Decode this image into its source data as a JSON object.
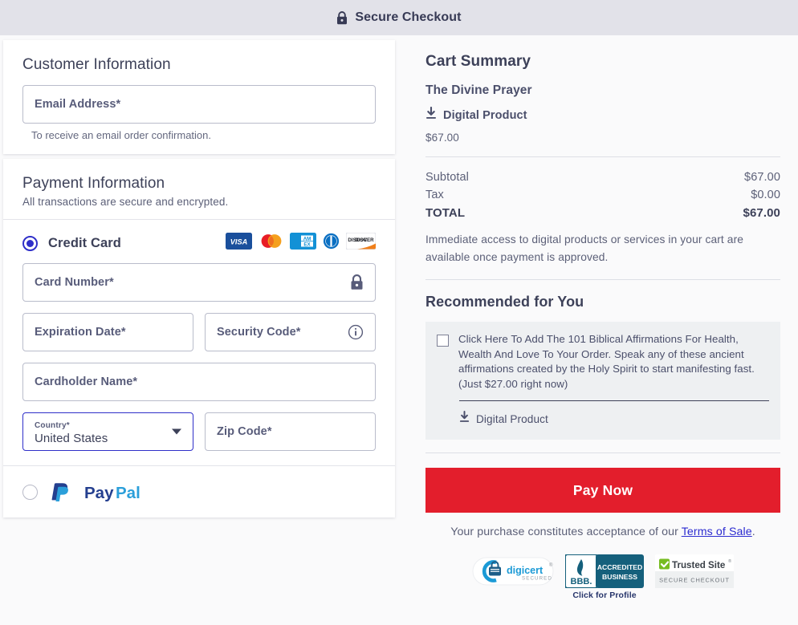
{
  "header": {
    "title": "Secure Checkout",
    "lock_icon": "lock-icon"
  },
  "customer": {
    "title": "Customer Information",
    "email_placeholder": "Email Address*",
    "email_value": "",
    "helper": "To receive an email order confirmation."
  },
  "payment": {
    "title": "Payment Information",
    "subtitle": "All transactions are secure and encrypted.",
    "methods": {
      "credit_card_label": "Credit Card",
      "credit_card_selected": true,
      "paypal_label": "PayPal",
      "paypal_selected": false
    },
    "card_brands": [
      "visa",
      "mastercard",
      "amex",
      "diners-club",
      "discover"
    ],
    "fields": {
      "card_number_placeholder": "Card Number*",
      "card_number_value": "",
      "expiration_placeholder": "Expiration Date*",
      "expiration_value": "",
      "security_code_placeholder": "Security Code*",
      "security_code_value": "",
      "cardholder_placeholder": "Cardholder Name*",
      "cardholder_value": "",
      "country_label": "Country*",
      "country_value": "United States",
      "zip_placeholder": "Zip Code*",
      "zip_value": ""
    },
    "icons": {
      "card_lock": "lock-icon",
      "security_info": "info-icon",
      "country_caret": "chevron-down-icon"
    }
  },
  "cart": {
    "title": "Cart Summary",
    "product_name": "The Divine Prayer",
    "product_type": "Digital Product",
    "product_price": "$67.00",
    "subtotal_label": "Subtotal",
    "subtotal_value": "$67.00",
    "tax_label": "Tax",
    "tax_value": "$0.00",
    "total_label": "TOTAL",
    "total_value": "$67.00",
    "access_note": "Immediate access to digital products or services in your cart are available once payment is approved."
  },
  "recommended": {
    "title": "Recommended for You",
    "offer_text": "Click Here To Add The 101 Biblical Affirmations For Health, Wealth And Love To Your Order. Speak any of these ancient affirmations created by the Holy Spirit to start manifesting fast. (Just $27.00 right now)",
    "offer_checked": false,
    "product_type": "Digital Product"
  },
  "checkout": {
    "pay_button": "Pay Now",
    "terms_prefix": "Your purchase constitutes acceptance of our ",
    "terms_link": "Terms of Sale",
    "terms_suffix": "."
  },
  "badges": {
    "digicert_name": "digicert",
    "digicert_sub": "SECURED",
    "bbb_line1": "ACCREDITED",
    "bbb_line2": "BUSINESS",
    "bbb_abbr": "BBB.",
    "bbb_click": "Click for Profile",
    "trustedsite_name1": "Trusted",
    "trustedsite_name2": "Site",
    "trustedsite_sub": "SECURE CHECKOUT"
  },
  "colors": {
    "accent_red": "#e31e2c",
    "accent_blue": "#2f2fc9",
    "header_bg": "#e2e2e9",
    "text_dark": "#3d4159",
    "upsell_bg": "#eef0f2"
  }
}
